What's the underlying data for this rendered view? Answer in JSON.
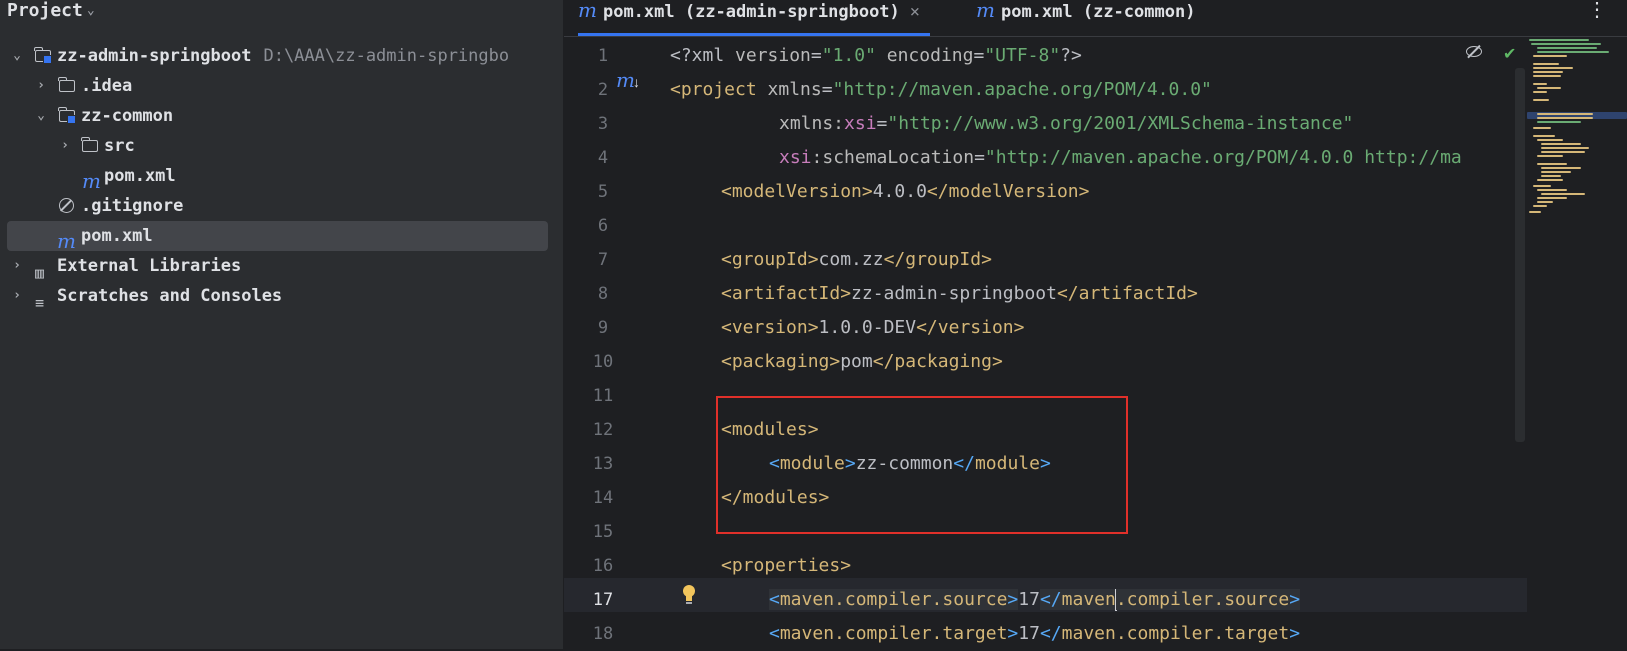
{
  "sidebar": {
    "title": "Project",
    "tree": [
      {
        "label": "zz-admin-springboot",
        "hint": "D:\\AAA\\zz-admin-springbo",
        "icon": "module-folder-icon",
        "expanded": true
      },
      {
        "label": ".idea",
        "icon": "folder-icon",
        "expanded": false
      },
      {
        "label": "zz-common",
        "icon": "module-folder-icon",
        "expanded": true
      },
      {
        "label": "src",
        "icon": "folder-icon",
        "expanded": false
      },
      {
        "label": "pom.xml",
        "icon": "maven-icon"
      },
      {
        "label": ".gitignore",
        "icon": "ignore-file-icon"
      },
      {
        "label": "pom.xml",
        "icon": "maven-icon",
        "selected": true
      },
      {
        "label": "External Libraries",
        "icon": "library-icon",
        "expanded": false
      },
      {
        "label": "Scratches and Consoles",
        "icon": "scratches-icon",
        "expanded": false
      }
    ]
  },
  "tabs": [
    {
      "label": "pom.xml (zz-admin-springboot)",
      "active": true,
      "close": "×"
    },
    {
      "label": "pom.xml (zz-common)",
      "active": false
    }
  ],
  "editor": {
    "current_line": 17,
    "line_numbers": [
      "1",
      "2",
      "3",
      "4",
      "5",
      "6",
      "7",
      "8",
      "9",
      "10",
      "11",
      "12",
      "13",
      "14",
      "15",
      "16",
      "17",
      "18"
    ],
    "lines": {
      "l1": {
        "a": "<?xml ",
        "b": "version",
        "c": "=",
        "d": "\"1.0\"",
        "e": " encoding",
        "f": "=",
        "g": "\"UTF-8\"",
        "h": "?>"
      },
      "l2": {
        "a": "<project ",
        "b": "xmlns",
        "c": "=",
        "d": "\"http://maven.apache.org/POM/4.0.0\""
      },
      "l3": {
        "a": "xmlns:",
        "b": "xsi",
        "c": "=",
        "d": "\"http://www.w3.org/2001/XMLSchema-instance\""
      },
      "l4": {
        "a": "xsi",
        "b": ":schemaLocation",
        "c": "=",
        "d": "\"http://maven.apache.org/POM/4.0.0 http://ma"
      },
      "l5": {
        "open": "<modelVersion>",
        "val": "4.0.0",
        "close": "</modelVersion>"
      },
      "l7": {
        "open": "<groupId>",
        "val": "com.zz",
        "close": "</groupId>"
      },
      "l8": {
        "open": "<artifactId>",
        "val": "zz-admin-springboot",
        "close": "</artifactId>"
      },
      "l9": {
        "open": "<version>",
        "val": "1.0.0-DEV",
        "close": "</version>"
      },
      "l10": {
        "open": "<packaging>",
        "val": "pom",
        "close": "</packaging>"
      },
      "l12": {
        "open": "<modules>"
      },
      "l13": {
        "lt": "<",
        "tag": "module",
        "gt": ">",
        "val": "zz-common",
        "lt2": "</",
        "tag2": "module",
        "gt2": ">"
      },
      "l14": {
        "close": "</modules>"
      },
      "l16": {
        "open": "<properties>"
      },
      "l17": {
        "lt": "<",
        "tag": "maven.compiler.source",
        "gt": ">",
        "val": "17",
        "lt2": "</",
        "tag2a": "maven",
        "tag2b": ".compiler.source",
        "gt2": ">"
      },
      "l18": {
        "lt": "<",
        "tag": "maven.compiler.target",
        "gt": ">",
        "val": "17",
        "lt2": "</",
        "tag2": "maven.compiler.target",
        "gt2": ">"
      }
    }
  },
  "colors": {
    "tag": "#d5b778",
    "string": "#6aab73",
    "namespace": "#c77dbb",
    "brace_match": "#56a8f5",
    "highlight_box": "#e0302a",
    "accent": "#3574f0"
  }
}
